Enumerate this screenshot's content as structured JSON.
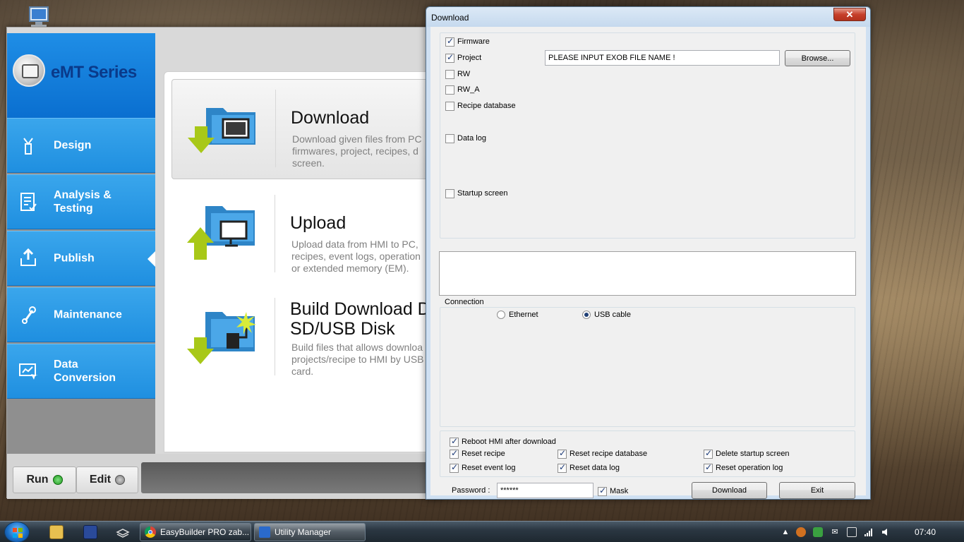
{
  "utility_manager": {
    "logo_text": "eMT Series",
    "nav": [
      {
        "label": "Design",
        "icon": "design-icon"
      },
      {
        "label": "Analysis &\nTesting",
        "icon": "analysis-icon"
      },
      {
        "label": "Publish",
        "icon": "publish-icon"
      },
      {
        "label": "Maintenance",
        "icon": "maintenance-icon"
      },
      {
        "label": "Data\nConversion",
        "icon": "data-conversion-icon"
      }
    ],
    "options": [
      {
        "title": "Download",
        "desc": "Download given files from PC\nfirmwares, project, recipes, d\nscreen."
      },
      {
        "title": "Upload",
        "desc": "Upload data from HMI to PC,\nrecipes, event logs, operation\nor extended memory (EM)."
      },
      {
        "title": "Build Download D\nSD/USB Disk",
        "desc": "Build files that allows downloa\nprojects/recipe to HMI by USB\ncard."
      }
    ],
    "run_label": "Run",
    "edit_label": "Edit"
  },
  "dialog": {
    "title": "Download",
    "close": "✕",
    "files": {
      "firmware": {
        "label": "Firmware",
        "checked": true
      },
      "project": {
        "label": "Project",
        "checked": true
      },
      "rw": {
        "label": "RW",
        "checked": false
      },
      "rw_a": {
        "label": "RW_A",
        "checked": false
      },
      "recipe_db": {
        "label": "Recipe database",
        "checked": false
      },
      "data_log": {
        "label": "Data log",
        "checked": false
      },
      "startup_screen": {
        "label": "Startup screen",
        "checked": false
      }
    },
    "project_path": "PLEASE INPUT EXOB FILE NAME !",
    "browse_label": "Browse...",
    "connection": {
      "label": "Connection",
      "ethernet": "Ethernet",
      "usb": "USB cable",
      "selected": "USB cable"
    },
    "options": {
      "reboot": "Reboot HMI after download",
      "reset_recipe": "Reset recipe",
      "reset_recipe_db": "Reset recipe database",
      "delete_startup": "Delete startup screen",
      "reset_event_log": "Reset event log",
      "reset_data_log": "Reset data log",
      "reset_operation_log": "Reset operation log"
    },
    "password_label": "Password :",
    "password_value": "******",
    "mask_label": "Mask",
    "download_button": "Download",
    "exit_button": "Exit"
  },
  "taskbar": {
    "items": [
      {
        "label": "EasyBuilder PRO zab...",
        "icon": "chrome-icon"
      },
      {
        "label": "Utility Manager",
        "icon": "utility-manager-icon"
      }
    ],
    "clock": "07:40"
  }
}
